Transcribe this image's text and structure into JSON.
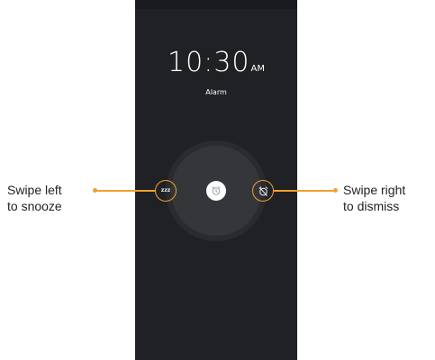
{
  "lockscreen": {
    "time": "10:30",
    "ampm": "AM",
    "label": "Alarm"
  },
  "actions": {
    "snooze_glyph": "zzz",
    "snooze_icon": "snooze-icon",
    "center_icon": "alarm-clock-icon",
    "dismiss_icon": "alarm-off-icon"
  },
  "callouts": {
    "left_line1": "Swipe left",
    "left_line2": "to snooze",
    "right_line1": "Swipe right",
    "right_line2": "to dismiss"
  },
  "colors": {
    "phone_bg": "#202124",
    "accent": "#f0a030",
    "ring_outer": "#2a2b2e",
    "ring_inner": "#35363a"
  }
}
